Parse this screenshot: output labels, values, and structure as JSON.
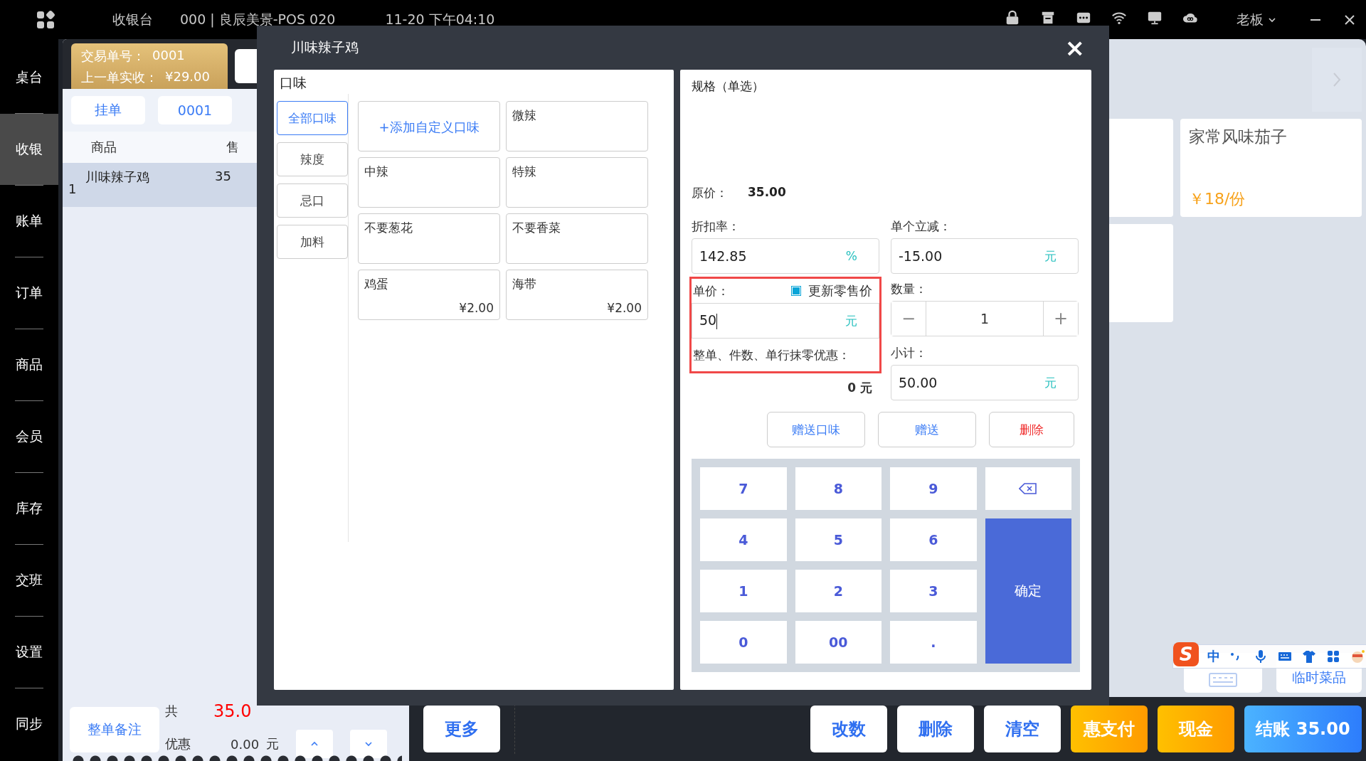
{
  "top_bar": {
    "app_title": "收银台",
    "store": "000 | 良辰美景-POS 020",
    "datetime": "11-20 下午04:10",
    "user": "老板"
  },
  "sidebar": {
    "items": [
      {
        "label": "桌台",
        "selected": false
      },
      {
        "label": "收银",
        "selected": true
      },
      {
        "label": "账单",
        "selected": false
      },
      {
        "label": "订单",
        "selected": false
      },
      {
        "label": "商品",
        "selected": false
      },
      {
        "label": "会员",
        "selected": false
      },
      {
        "label": "库存",
        "selected": false
      },
      {
        "label": "交班",
        "selected": false
      },
      {
        "label": "设置",
        "selected": false
      },
      {
        "label": "同步",
        "selected": false
      }
    ]
  },
  "order_panel": {
    "transaction_label": "交易单号：",
    "transaction_no": "0001",
    "last_paid_label": "上一单实收：",
    "last_paid": "¥29.00",
    "tabs": [
      "挂单",
      "0001"
    ],
    "columns": [
      "商品",
      "售"
    ],
    "rows": [
      {
        "index": "1",
        "name": "川味辣子鸡",
        "price": "35",
        "selected": true
      }
    ],
    "note_button": "整单备注",
    "total_label": "共",
    "total": "35.0",
    "discount_label": "优惠",
    "discount": "0.00",
    "discount_unit": "元"
  },
  "product_grid": {
    "products": [
      {
        "name": "家常风味茄子",
        "price": "￥18/份"
      }
    ],
    "temp_item_button": "临时菜品"
  },
  "ime_bar": {
    "logo": "S",
    "mode": "中"
  },
  "bottom_bar": {
    "more_button": "更多",
    "actions": [
      {
        "label": "改数",
        "kind": "plain"
      },
      {
        "label": "删除",
        "kind": "plain"
      },
      {
        "label": "清空",
        "kind": "plain"
      },
      {
        "label": "惠支付",
        "kind": "orange"
      },
      {
        "label": "现金",
        "kind": "orange"
      },
      {
        "label": "结账 35.00",
        "kind": "primary"
      }
    ]
  },
  "dialog": {
    "title": "川味辣子鸡",
    "close": "×",
    "flavor": {
      "title": "口味",
      "categories": [
        {
          "label": "全部口味",
          "selected": true
        },
        {
          "label": "辣度",
          "selected": false
        },
        {
          "label": "忌口",
          "selected": false
        },
        {
          "label": "加料",
          "selected": false
        }
      ],
      "options": [
        {
          "label": "+添加自定义口味",
          "kind": "add"
        },
        {
          "label": "微辣",
          "kind": "option"
        },
        {
          "label": "中辣",
          "kind": "option"
        },
        {
          "label": "特辣",
          "kind": "option"
        },
        {
          "label": "不要葱花",
          "kind": "option"
        },
        {
          "label": "不要香菜",
          "kind": "option"
        },
        {
          "label": "鸡蛋",
          "kind": "option",
          "price": "¥2.00"
        },
        {
          "label": "海带",
          "kind": "option",
          "price": "¥2.00"
        }
      ]
    },
    "spec": {
      "title": "规格（单选）",
      "original_price_label": "原价：",
      "original_price": "35.00",
      "discount_rate": {
        "label": "折扣率：",
        "value": "142.85",
        "unit": "%"
      },
      "unit_reduction": {
        "label": "单个立减：",
        "value": "-15.00",
        "unit": "元"
      },
      "unit_price": {
        "label": "单价：",
        "value": "50",
        "unit": "元",
        "highlighted": true
      },
      "update_retail": {
        "label": "更新零售价",
        "checked": true
      },
      "rounding": {
        "label": "整单、件数、单行抹零优惠：",
        "value": "0 元"
      },
      "quantity": {
        "label": "数量：",
        "value": "1",
        "minus": "−",
        "plus": "+"
      },
      "subtotal": {
        "label": "小计：",
        "value": "50.00",
        "unit": "元"
      },
      "actions": [
        {
          "label": "赠送口味",
          "kind": "normal"
        },
        {
          "label": "赠送",
          "kind": "normal"
        },
        {
          "label": "删除",
          "kind": "danger"
        }
      ],
      "keypad": [
        {
          "label": "7",
          "kind": "digit"
        },
        {
          "label": "8",
          "kind": "digit"
        },
        {
          "label": "9",
          "kind": "digit"
        },
        {
          "kind": "backspace"
        },
        {
          "label": "4",
          "kind": "digit"
        },
        {
          "label": "5",
          "kind": "digit"
        },
        {
          "label": "6",
          "kind": "digit"
        },
        {
          "label": "1",
          "kind": "digit"
        },
        {
          "label": "2",
          "kind": "digit"
        },
        {
          "label": "3",
          "kind": "digit"
        },
        {
          "label": "确定",
          "kind": "confirm"
        },
        {
          "label": "0",
          "kind": "digit"
        },
        {
          "label": "00",
          "kind": "digit"
        },
        {
          "label": ".",
          "kind": "digit"
        }
      ]
    }
  }
}
